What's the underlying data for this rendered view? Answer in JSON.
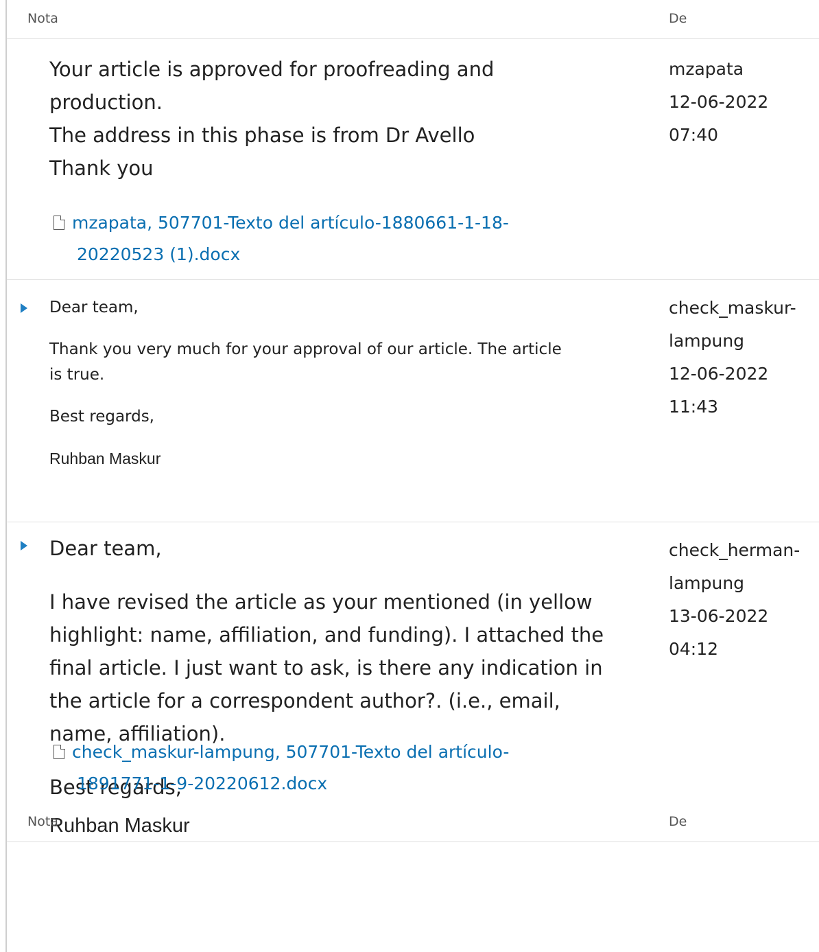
{
  "header": {
    "note_col": "Nota",
    "from_col": "De"
  },
  "notes": [
    {
      "lines": [
        "Your article is approved for proofreading and",
        "production.",
        "The address in this phase is from Dr Avello",
        "Thank you"
      ],
      "from_user": "mzapata",
      "date": "12-06-2022",
      "time": "07:40",
      "attachment_line1": "mzapata, 507701-Texto del artículo-1880661-1-18-",
      "attachment_line2": "20220523 (1).docx"
    },
    {
      "greeting": "Dear team,",
      "body1": "Thank you very much for your approval of our article. The article",
      "body2": "is true.",
      "closing": "Best regards,",
      "signature": "Ruhban Maskur",
      "from_user1": "check_maskur-",
      "from_user2": "lampung",
      "date": "12-06-2022",
      "time": "11:43"
    },
    {
      "greeting": "Dear team,",
      "body": [
        "I have revised the article as your mentioned (in yellow",
        "highlight: name, affiliation, and funding).  I attached the",
        "final article.  I just want to ask, is there any indication in",
        "the article for a correspondent author?. (i.e., email,",
        "name, affiliation)."
      ],
      "closing": "Best regards,",
      "signature": "Ruhban Maskur",
      "from_user1": "check_herman-",
      "from_user2": "lampung",
      "date": "13-06-2022",
      "time": "04:12",
      "attachment_line1": "check_maskur-lampung, 507701-Texto del artículo-",
      "attachment_line2": "1891771-1-9-20220612.docx"
    }
  ]
}
